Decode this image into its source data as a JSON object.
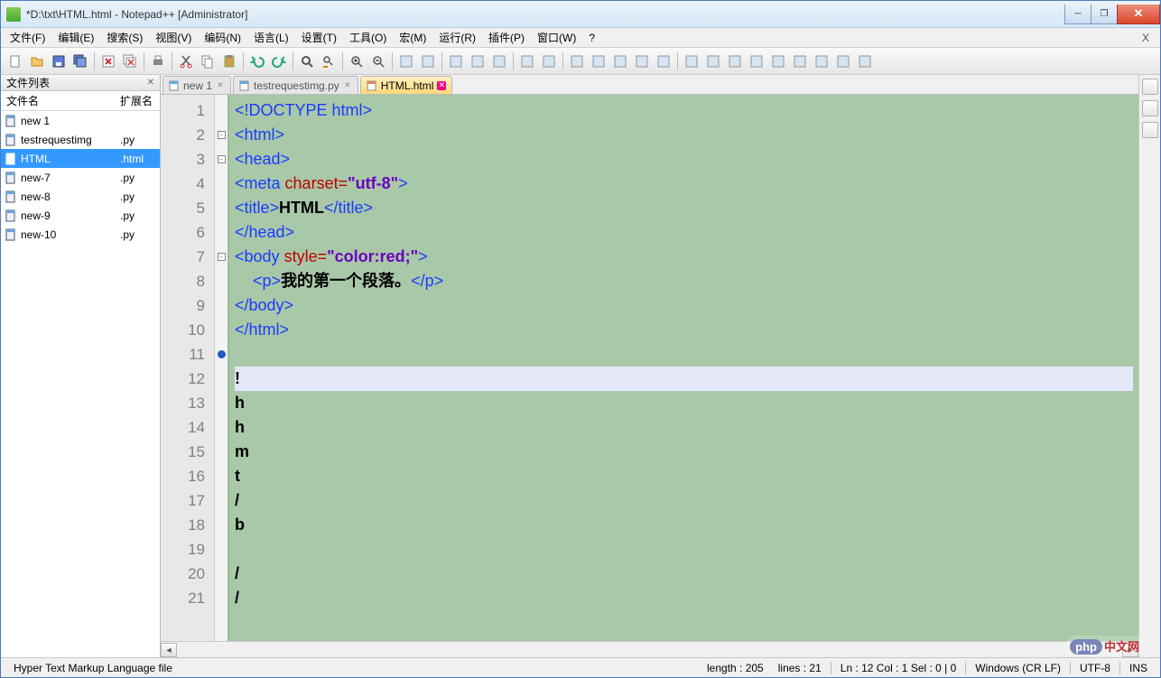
{
  "title": "*D:\\txt\\HTML.html - Notepad++ [Administrator]",
  "menus": [
    "文件(F)",
    "编辑(E)",
    "搜索(S)",
    "视图(V)",
    "编码(N)",
    "语言(L)",
    "设置(T)",
    "工具(O)",
    "宏(M)",
    "运行(R)",
    "插件(P)",
    "窗口(W)",
    "?"
  ],
  "sidebar": {
    "title": "文件列表",
    "col_name": "文件名",
    "col_ext": "扩展名",
    "files": [
      {
        "name": "new 1",
        "ext": "",
        "active": false
      },
      {
        "name": "testrequestimg",
        "ext": ".py",
        "active": false
      },
      {
        "name": "HTML",
        "ext": ".html",
        "active": true
      },
      {
        "name": "new-7",
        "ext": ".py",
        "active": false
      },
      {
        "name": "new-8",
        "ext": ".py",
        "active": false
      },
      {
        "name": "new-9",
        "ext": ".py",
        "active": false
      },
      {
        "name": "new-10",
        "ext": ".py",
        "active": false
      }
    ]
  },
  "tabs": [
    {
      "label": "new 1",
      "active": false,
      "ext": "txt"
    },
    {
      "label": "testrequestimg.py",
      "active": false,
      "ext": "py"
    },
    {
      "label": "HTML.html",
      "active": true,
      "ext": "html"
    }
  ],
  "code": {
    "lines": [
      {
        "n": 1,
        "fold": "",
        "html": "<span class='tag'>&lt;!DOCTYPE html&gt;</span>"
      },
      {
        "n": 2,
        "fold": "box",
        "html": "<span class='tag'>&lt;html&gt;</span>"
      },
      {
        "n": 3,
        "fold": "box",
        "html": "<span class='tag'>&lt;head&gt;</span>"
      },
      {
        "n": 4,
        "fold": "",
        "html": "<span class='tag'>&lt;meta</span> <span class='attr'>charset=</span><span class='str'>\"utf-8\"</span><span class='tag'>&gt;</span>"
      },
      {
        "n": 5,
        "fold": "",
        "html": "<span class='tag'>&lt;title&gt;</span><span class='txt'>HTML</span><span class='tag'>&lt;/title&gt;</span>"
      },
      {
        "n": 6,
        "fold": "",
        "html": "<span class='tag'>&lt;/head&gt;</span>"
      },
      {
        "n": 7,
        "fold": "box",
        "html": "<span class='tag'>&lt;body</span> <span class='attr'>style=</span><span class='str'>\"color:red;\"</span><span class='tag'>&gt;</span>"
      },
      {
        "n": 8,
        "fold": "",
        "html": "    <span class='tag'>&lt;p&gt;</span><span class='txt'>我的第一个段落。</span><span class='tag'>&lt;/p&gt;</span>"
      },
      {
        "n": 9,
        "fold": "",
        "html": "<span class='tag'>&lt;/body&gt;</span>"
      },
      {
        "n": 10,
        "fold": "",
        "html": "<span class='tag'>&lt;/html&gt;</span>"
      },
      {
        "n": 11,
        "fold": "dot",
        "html": "<span style='color:#c8a070'>      </span>"
      },
      {
        "n": 12,
        "fold": "",
        "html": "<span class='txt'>!</span>",
        "hl": true
      },
      {
        "n": 13,
        "fold": "",
        "html": "<span class='txt'>h</span>"
      },
      {
        "n": 14,
        "fold": "",
        "html": "<span class='txt'>h</span>"
      },
      {
        "n": 15,
        "fold": "",
        "html": "<span class='txt'>m</span>"
      },
      {
        "n": 16,
        "fold": "",
        "html": "<span class='txt'>t</span>"
      },
      {
        "n": 17,
        "fold": "",
        "html": "<span class='txt'>/</span>"
      },
      {
        "n": 18,
        "fold": "",
        "html": "<span class='txt'>b</span>"
      },
      {
        "n": 19,
        "fold": "",
        "html": ""
      },
      {
        "n": 20,
        "fold": "",
        "html": "<span class='txt'>/</span>"
      },
      {
        "n": 21,
        "fold": "",
        "html": "<span class='txt'>/</span>"
      }
    ]
  },
  "status": {
    "lang": "Hyper Text Markup Language file",
    "length": "length : 205",
    "lines": "lines : 21",
    "pos": "Ln : 12    Col : 1    Sel : 0 | 0",
    "eol": "Windows (CR LF)",
    "enc": "UTF-8",
    "ins": "INS"
  },
  "icons": {
    "toolbar": [
      "new-file",
      "open-file",
      "save",
      "save-all",
      "|",
      "close",
      "close-all",
      "|",
      "print",
      "|",
      "cut",
      "copy",
      "paste",
      "|",
      "undo",
      "redo",
      "|",
      "find",
      "replace",
      "|",
      "zoom-in",
      "zoom-out",
      "|",
      "sync-v",
      "sync-h",
      "|",
      "wrap",
      "show-all",
      "indent-guide",
      "|",
      "lang",
      "eye",
      "|",
      "record",
      "stop",
      "play",
      "play-multi",
      "save-macro",
      "|",
      "outdent",
      "indent",
      "wrap2",
      "fold",
      "unfold",
      "hide",
      "expand",
      "spellcheck",
      "abc"
    ]
  },
  "watermark": {
    "php": "php",
    "text": "中文网"
  }
}
